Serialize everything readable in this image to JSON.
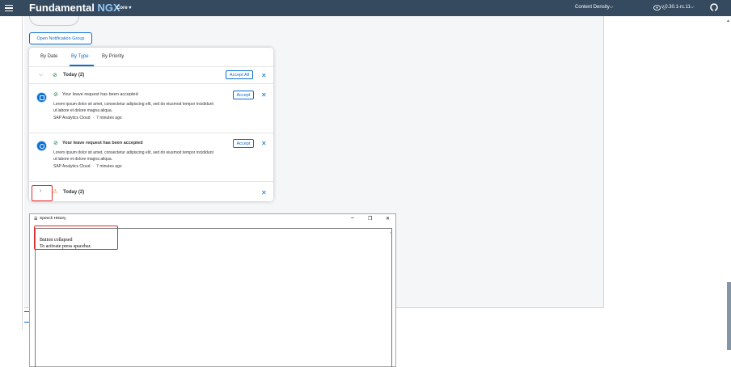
{
  "shellbar": {
    "brand": "Fundamental",
    "brand_accent": "NGX",
    "core_menu": "Core ▾",
    "content_density": "Content Density⌵",
    "theme_menu": "⌵",
    "version": "v.0.30.1-rc.11⌵"
  },
  "example": {
    "open_button": "Open Notification Group"
  },
  "notification_group": {
    "tabs": [
      {
        "label": "By Date"
      },
      {
        "label": "By Type"
      },
      {
        "label": "By Priority"
      }
    ],
    "active_tab": "By Type",
    "groups": [
      {
        "title": "Today (2)",
        "status": "success",
        "expanded": true,
        "accept_all_label": "Accept All",
        "close_label": "✕"
      },
      {
        "title": "Today (2)",
        "status": "warning",
        "expanded": false,
        "close_label": "✕"
      }
    ],
    "notifications": [
      {
        "title": "Your leave request has been accepted",
        "body": "Lorem ipsum dolor sit amet, consectetur adipiscing elit, sed do eiusmod tempor incididunt ut labore et dolore magna aliqua.",
        "source": "SAP Analytics Cloud",
        "time": "7 minutes ago",
        "accept_label": "Accept",
        "close_label": "✕",
        "unread": false
      },
      {
        "title": "Your leave request has been accepted",
        "body": "Lorem ipsum dolor sit amet, consectetur adipiscing elit, sed do eiusmod tempor incididunt ut labore et dolore magna aliqua.",
        "source": "SAP Analytics Cloud",
        "time": "7 minutes ago",
        "accept_label": "Accept",
        "close_label": "✕",
        "unread": true
      }
    ]
  },
  "speech_history": {
    "title": "Speech History",
    "minimize": "–",
    "maximize": "❐",
    "close": "✕",
    "lines": [
      "Button collapsed",
      "To activate press spacebar."
    ]
  },
  "colors": {
    "shellbar_bg": "#354a5f",
    "brand_accent": "#91c8f6",
    "accent": "#0a6ed1",
    "success": "#107e3e",
    "warning": "#e9730c",
    "focus_highlight": "#e32929"
  },
  "icons": {
    "menu": "hamburger-icon",
    "theme": "palette-icon",
    "github": "github-icon",
    "success": "success-status-icon",
    "warning": "warning-status-icon",
    "expand": "chevron-right-icon",
    "collapse": "chevron-down-icon"
  }
}
